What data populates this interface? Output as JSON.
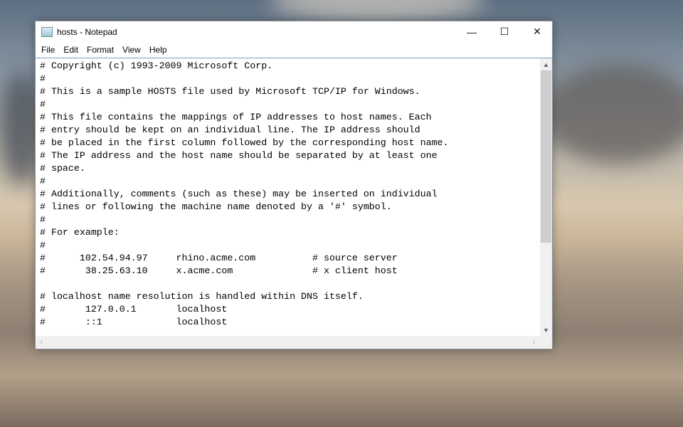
{
  "window": {
    "title": "hosts - Notepad",
    "controls": {
      "minimize": "—",
      "maximize": "☐",
      "close": "✕"
    }
  },
  "menu": [
    "File",
    "Edit",
    "Format",
    "View",
    "Help"
  ],
  "editor": {
    "lines": [
      "# Copyright (c) 1993-2009 Microsoft Corp.",
      "#",
      "# This is a sample HOSTS file used by Microsoft TCP/IP for Windows.",
      "#",
      "# This file contains the mappings of IP addresses to host names. Each",
      "# entry should be kept on an individual line. The IP address should",
      "# be placed in the first column followed by the corresponding host name.",
      "# The IP address and the host name should be separated by at least one",
      "# space.",
      "#",
      "# Additionally, comments (such as these) may be inserted on individual",
      "# lines or following the machine name denoted by a '#' symbol.",
      "#",
      "# For example:",
      "#",
      "#      102.54.94.97     rhino.acme.com          # source server",
      "#       38.25.63.10     x.acme.com              # x client host",
      "",
      "# localhost name resolution is handled within DNS itself.",
      "#       127.0.0.1       localhost",
      "#       ::1             localhost"
    ]
  }
}
